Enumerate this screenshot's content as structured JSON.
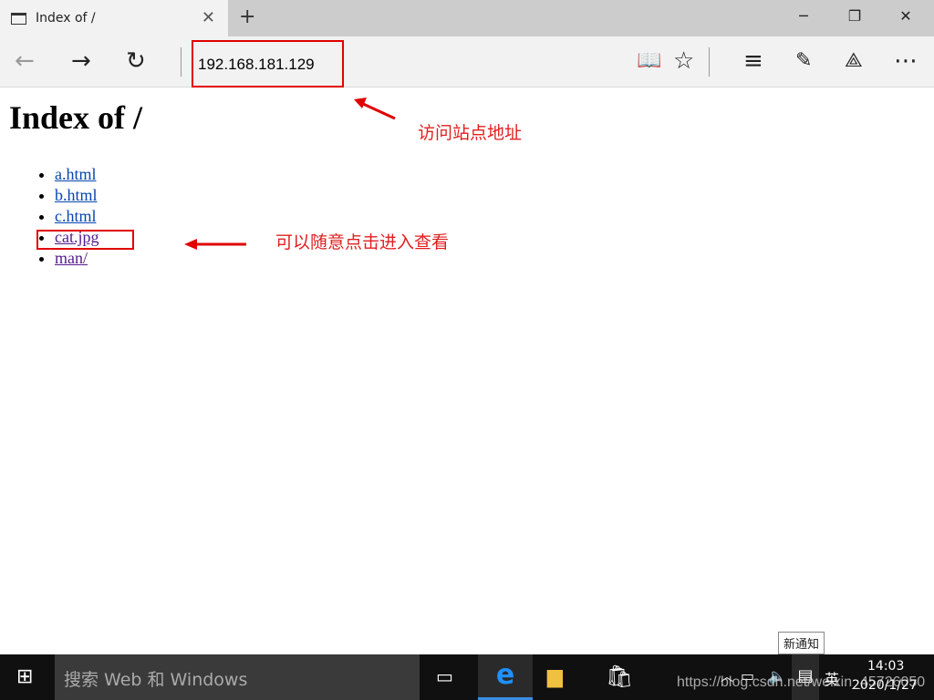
{
  "browser": {
    "tab_title": "Index of /",
    "address": "192.168.181.129"
  },
  "page": {
    "heading": "Index of /",
    "links": [
      "a.html",
      "b.html",
      "c.html",
      "cat.jpg",
      "man/"
    ]
  },
  "annotations": {
    "address_note": "访问站点地址",
    "link_note": "可以随意点击进入查看"
  },
  "taskbar": {
    "search_placeholder": "搜索 Web 和 Windows",
    "time": "14:03",
    "date": "2020/1/27",
    "ime": "英",
    "notification_tooltip": "新通知"
  },
  "watermark": "https://blog.csdn.net/weixin_45726050",
  "colors": {
    "annotation": "#e00000",
    "link": "#0645ad",
    "visited": "#551a8b"
  }
}
